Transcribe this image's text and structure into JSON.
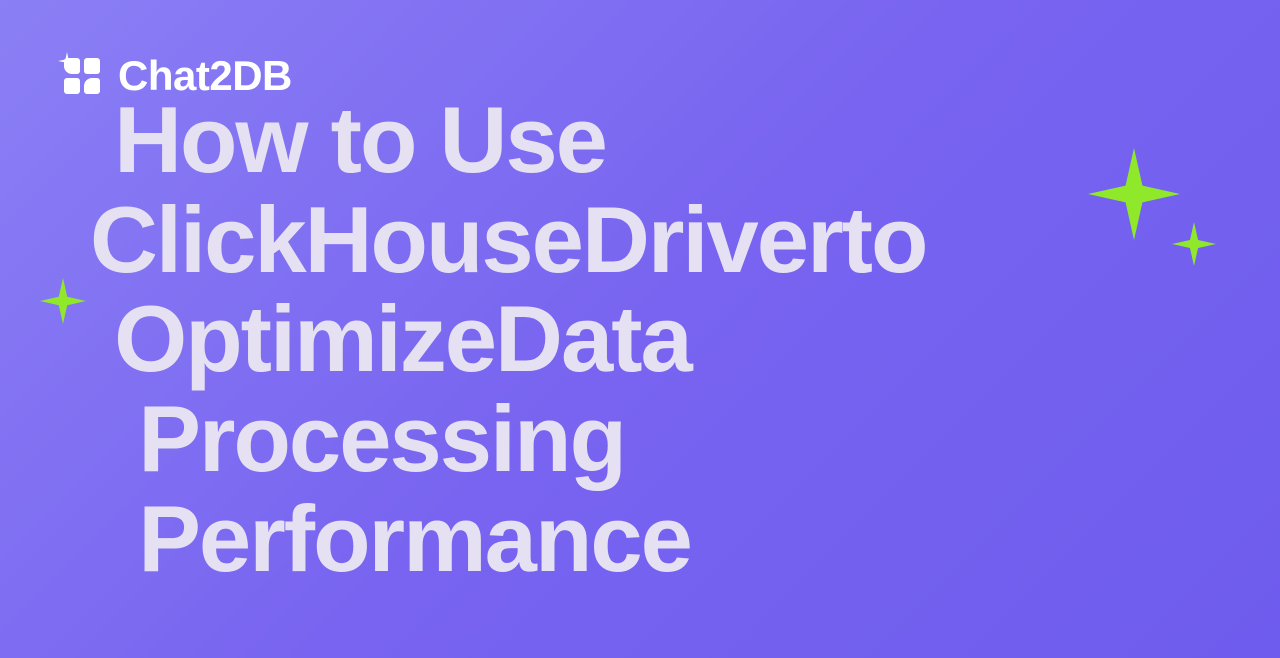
{
  "logo": {
    "text": "Chat2DB"
  },
  "headline": {
    "line1": "How to Use",
    "line2": "ClickHouseDriverto",
    "line3": "OptimizeData",
    "line4": "Processing",
    "line5": "Performance"
  },
  "colors": {
    "sparkle": "#8fe92a",
    "text": "#e6e1f2"
  }
}
